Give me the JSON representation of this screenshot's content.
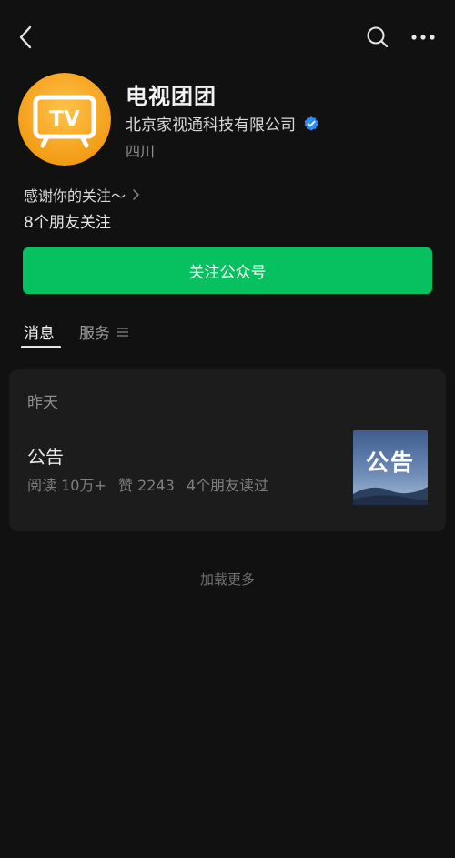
{
  "header": {
    "back_icon": "chevron-left-icon",
    "search_icon": "search-icon",
    "more_icon": "more-dots-icon"
  },
  "profile": {
    "avatar_text": "TV",
    "name": "电视团团",
    "company": "北京家视通科技有限公司",
    "verified_icon": "verified-badge-icon",
    "location": "四川",
    "thanks": "感谢你的关注～",
    "friends_following": "8个朋友关注"
  },
  "actions": {
    "follow_label": "关注公众号"
  },
  "tabs": [
    {
      "label": "消息",
      "active": true
    },
    {
      "label": "服务",
      "active": false
    }
  ],
  "feed": {
    "date_label": "昨天",
    "articles": [
      {
        "title": "公告",
        "reads": "阅读 10万+",
        "likes": "赞 2243",
        "friends_read": "4个朋友读过",
        "thumb_text": "公告"
      }
    ],
    "load_more": "加载更多"
  },
  "colors": {
    "background": "#111111",
    "card": "#1c1c1c",
    "accent_green": "#07c160",
    "avatar_orange": "#f5a623",
    "verified_blue": "#2f8cf5"
  }
}
